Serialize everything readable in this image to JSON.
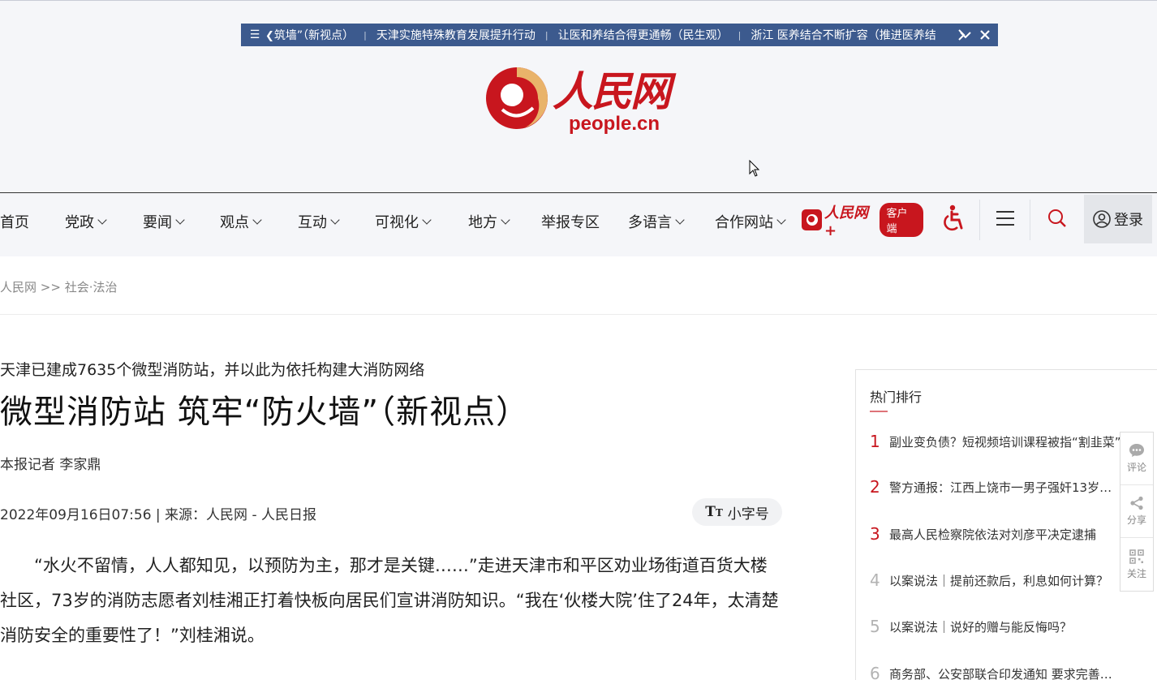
{
  "ticker": {
    "items": [
      "筑墙”（新视点）",
      "天津实施特殊教育发展提升行动",
      "让医和养结合得更通畅（民生观）",
      "浙江 医养结合不断扩容（推进医养结"
    ],
    "separator": "|"
  },
  "logo": {
    "cn": "人民网",
    "en": "people.cn"
  },
  "nav": {
    "items": [
      {
        "label": "首页"
      },
      {
        "label": "党政"
      },
      {
        "label": "要闻"
      },
      {
        "label": "观点"
      },
      {
        "label": "互动"
      },
      {
        "label": "可视化"
      },
      {
        "label": "地方"
      },
      {
        "label": "举报专区"
      },
      {
        "label": "多语言"
      },
      {
        "label": "合作网站"
      }
    ],
    "app_name": "人民网+",
    "app_pill": "客户端",
    "login": "登录"
  },
  "breadcrumb": {
    "home": "人民网",
    "sep": ">>",
    "section": "社会·法治"
  },
  "article": {
    "subtitle": "天津已建成7635个微型消防站，并以此为依托构建大消防网络",
    "title": "微型消防站  筑牢“防火墙”（新视点）",
    "author": "本报记者  李家鼎",
    "meta": "2022年09月16日07:56 | 来源：人民网 - 人民日报",
    "font_size_label": "小字号",
    "body": "“水火不留情，人人都知见，以预防为主，那才是关键……”走进天津市和平区劝业场街道百货大楼社区，73岁的消防志愿者刘桂湘正打着快板向居民们宣讲消防知识。“我在‘伙楼大院’住了24年，太清楚消防安全的重要性了！”刘桂湘说。"
  },
  "hot": {
    "title": "热门排行",
    "items": [
      {
        "rank": "1",
        "text": "副业变负债？短视频培训课程被指“割韭菜”"
      },
      {
        "rank": "2",
        "text": "警方通报：江西上饶市一男子强奸13岁…"
      },
      {
        "rank": "3",
        "text": "最高人民检察院依法对刘彦平决定逮捕"
      },
      {
        "rank": "4",
        "text": "以案说法｜提前还款后，利息如何计算？"
      },
      {
        "rank": "5",
        "text": "以案说法｜说好的赠与能反悔吗？"
      },
      {
        "rank": "6",
        "text": "商务部、公安部联合印发通知 要求完善…"
      }
    ]
  },
  "side": {
    "comment": "评论",
    "share": "分享",
    "follow": "关注"
  }
}
